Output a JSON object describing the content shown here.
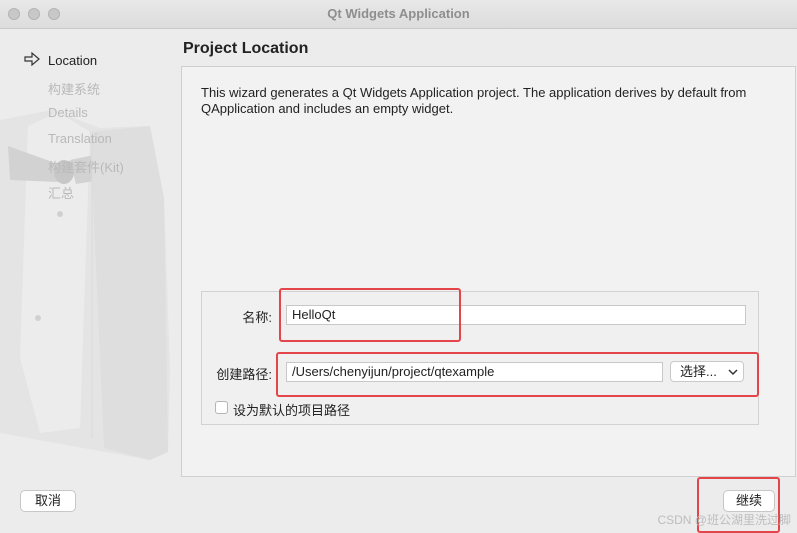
{
  "window": {
    "title": "Qt Widgets Application"
  },
  "sidebar": {
    "steps": [
      {
        "label": "Location",
        "active": true
      },
      {
        "label": "构建系统",
        "active": false
      },
      {
        "label": "Details",
        "active": false
      },
      {
        "label": "Translation",
        "active": false
      },
      {
        "label": "构建套件(Kit)",
        "active": false
      },
      {
        "label": "汇总",
        "active": false
      }
    ]
  },
  "page": {
    "title": "Project Location",
    "description": "This wizard generates a Qt Widgets Application project. The application derives by default from QApplication and includes an empty widget."
  },
  "form": {
    "name_label": "名称:",
    "name_value": "HelloQt",
    "path_label": "创建路径:",
    "path_value": "/Users/chenyijun/project/qtexample",
    "browse_label": "选择...",
    "default_path_label": "设为默认的项目路径",
    "default_path_checked": false
  },
  "buttons": {
    "cancel": "取消",
    "continue": "继续"
  },
  "watermark": "CSDN @班公湖里洗过脚",
  "colors": {
    "highlight": "#e3454a",
    "background": "#ececec"
  }
}
